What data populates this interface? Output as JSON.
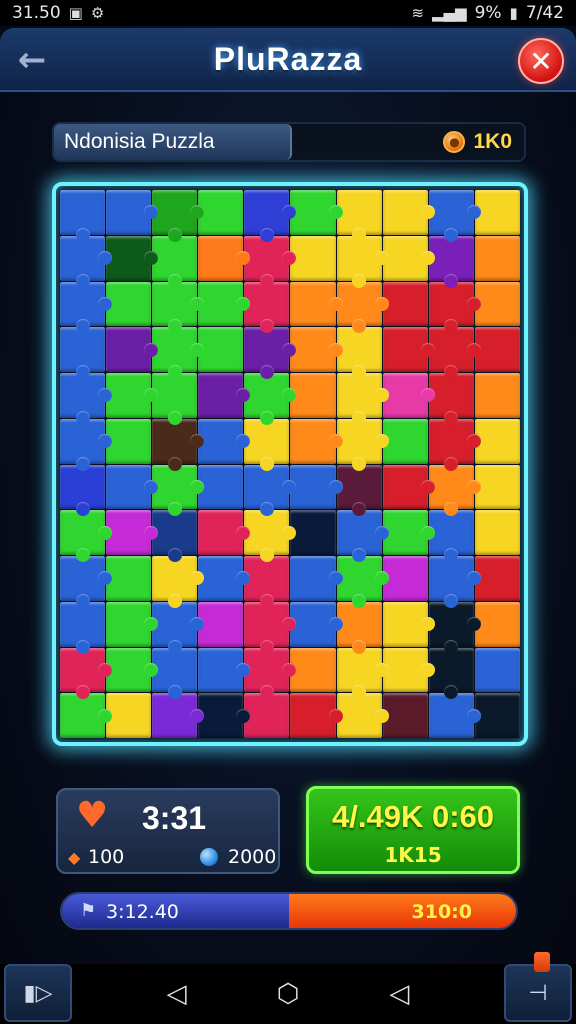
{
  "status_bar": {
    "time": "31.50",
    "battery": "9%",
    "clock_right": "7/42"
  },
  "header": {
    "title": "PluRazza"
  },
  "puzzle": {
    "name": "Ndonisia Puzzla",
    "coins": "1K0"
  },
  "board": {
    "cols": 10,
    "rows": 12,
    "colors": [
      "#2a63d6",
      "#2a63d6",
      "#1fa61f",
      "#2fd62f",
      "#2f3fd6",
      "#2fd62f",
      "#f7d623",
      "#f7d623",
      "#2a63d6",
      "#f7d623",
      "#2a63d6",
      "#0d5a1a",
      "#2fd62f",
      "#ff7a1a",
      "#e0245a",
      "#f7d623",
      "#f7d623",
      "#f7d623",
      "#7a1fb8",
      "#ff8a1a",
      "#2a63d6",
      "#2fd62f",
      "#2fd62f",
      "#2fd62f",
      "#e0245a",
      "#ff8a1a",
      "#ff8a1a",
      "#d61f2a",
      "#d61f2a",
      "#ff8a1a",
      "#2a63d6",
      "#6a1fa6",
      "#2fd62f",
      "#2fd62f",
      "#6a1fa6",
      "#ff8a1a",
      "#f7d623",
      "#d61f2a",
      "#d61f2a",
      "#d61f2a",
      "#2a63d6",
      "#2fd62f",
      "#2fd62f",
      "#6a1fa6",
      "#2fd62f",
      "#ff8a1a",
      "#f7d623",
      "#e83aa6",
      "#d61f2a",
      "#ff8a1a",
      "#2a63d6",
      "#2fd62f",
      "#4a2a1a",
      "#2a63d6",
      "#f7d623",
      "#ff8a1a",
      "#f7d623",
      "#2fd62f",
      "#d61f2a",
      "#f7d623",
      "#2a3fd6",
      "#2a63d6",
      "#2fd62f",
      "#2a63d6",
      "#2a63d6",
      "#2a63d6",
      "#5a1a3a",
      "#d61f2a",
      "#ff8a1a",
      "#f7d623",
      "#2fd62f",
      "#c42ad6",
      "#1a3a8c",
      "#e0245a",
      "#f7d623",
      "#0a1a3a",
      "#2a63d6",
      "#2fd62f",
      "#2a63d6",
      "#f7d623",
      "#2a63d6",
      "#2fd62f",
      "#f7d623",
      "#2a63d6",
      "#e0245a",
      "#2a63d6",
      "#2fd62f",
      "#c42ad6",
      "#2a63d6",
      "#d61f2a",
      "#2a63d6",
      "#2fd62f",
      "#2a63d6",
      "#c42ad6",
      "#e0245a",
      "#2a63d6",
      "#ff8a1a",
      "#f7d623",
      "#0a1a2a",
      "#ff8a1a",
      "#e0245a",
      "#2fd62f",
      "#2a63d6",
      "#2a63d6",
      "#e0245a",
      "#ff8a1a",
      "#f7d623",
      "#f7d623",
      "#0a1a2a",
      "#2a63d6",
      "#2fd62f",
      "#f7d623",
      "#7a2ad6",
      "#0a1a3a",
      "#e0245a",
      "#d61f2a",
      "#f7d623",
      "#5a1a2a",
      "#2a63d6",
      "#0a1a2a"
    ]
  },
  "stats": {
    "timer": "3:31",
    "gems": "100",
    "orbs": "2000",
    "score": "4/.49K 0:60",
    "score_sub": "1K15"
  },
  "progress": {
    "left_text": "3:12.40",
    "right_text": "310:0",
    "fraction": 0.5
  },
  "icons": {
    "back": "arrow-left-icon",
    "close": "close-icon",
    "heart": "heart-icon",
    "gem": "gem-icon",
    "orb": "orb-icon",
    "coin": "coin-icon"
  }
}
